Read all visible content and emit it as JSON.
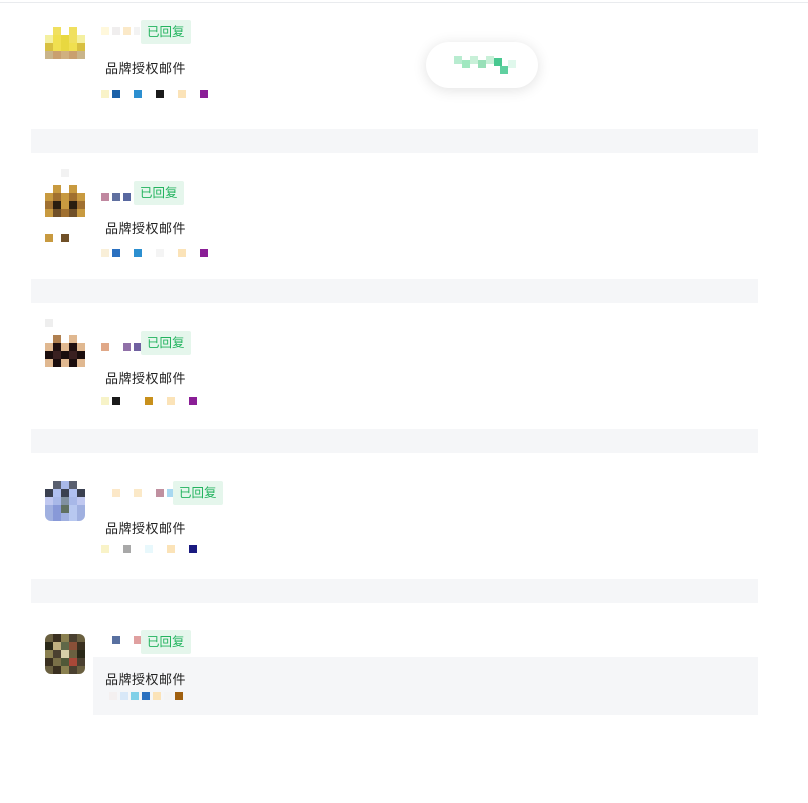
{
  "messages": [
    {
      "badge": "已回复",
      "subject": "品牌授权邮件"
    },
    {
      "badge": "已回复",
      "subject": "品牌授权邮件"
    },
    {
      "badge": "已回复",
      "subject": "品牌授权邮件"
    },
    {
      "badge": "已回复",
      "subject": "品牌授权邮件"
    },
    {
      "badge": "已回复",
      "subject": "品牌授权邮件"
    }
  ],
  "colors": {
    "badge_bg": "#e5f6ec",
    "badge_text": "#22b35e",
    "separator": "#f5f6f8",
    "hover_row": "#f5f6f8"
  }
}
